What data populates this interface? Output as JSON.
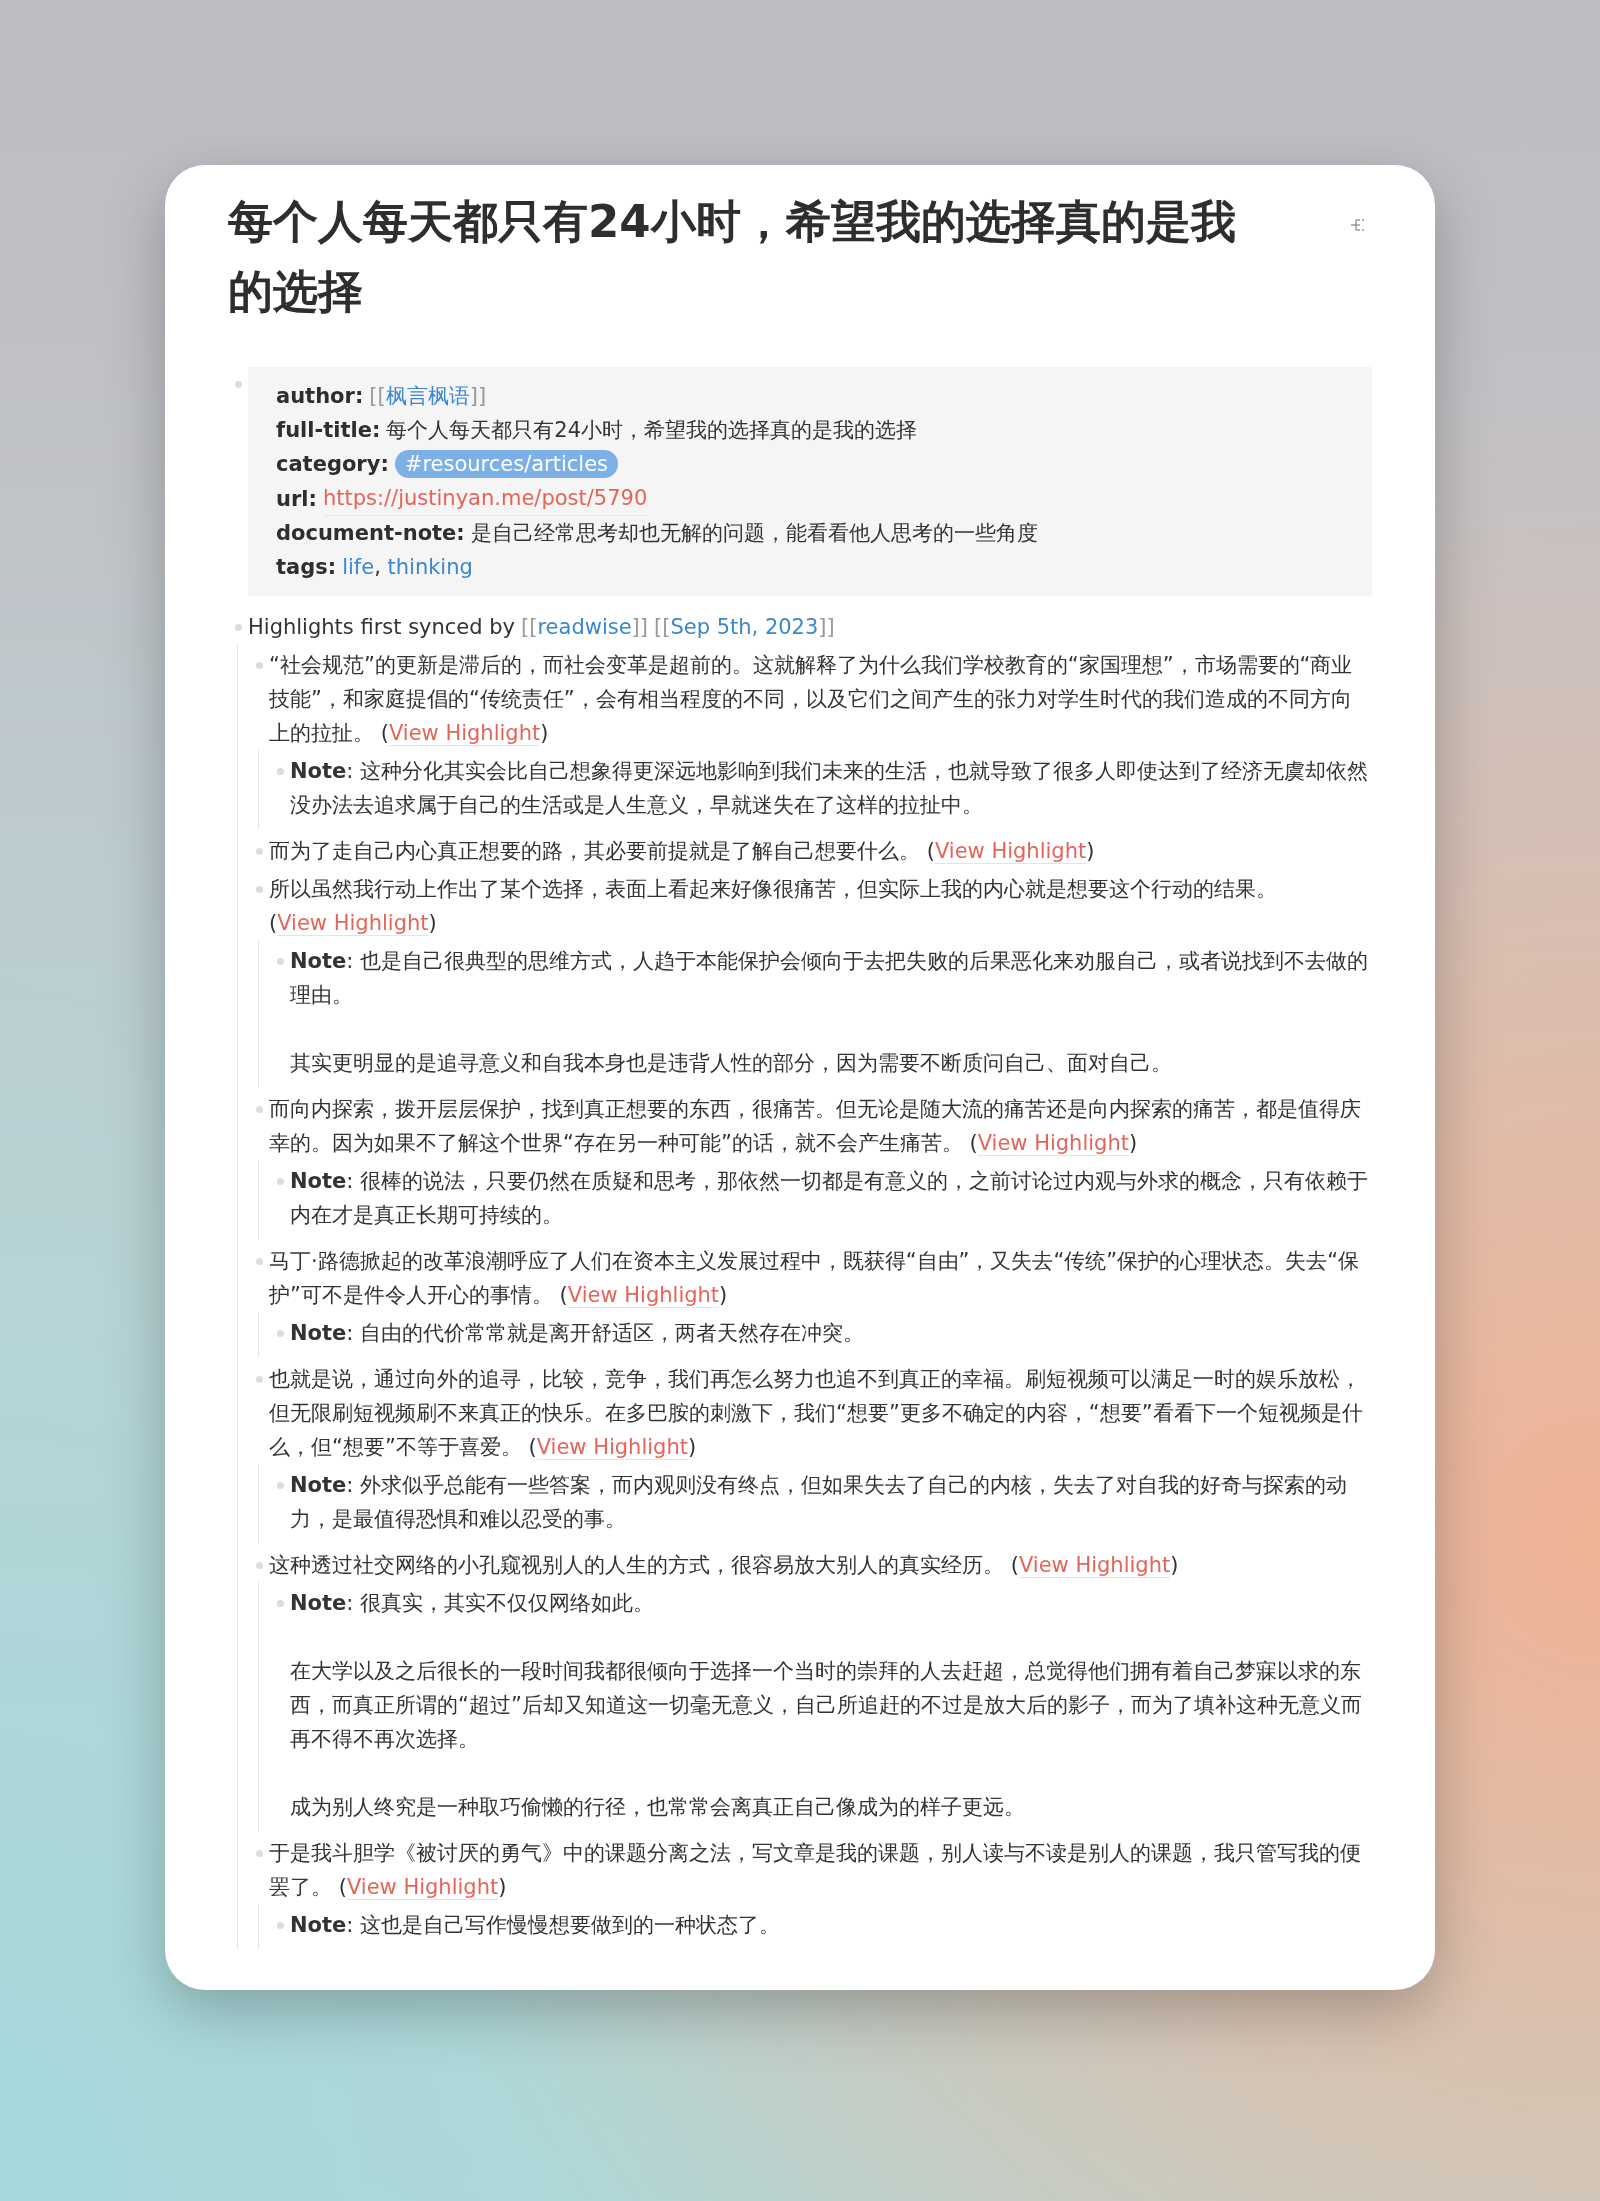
{
  "title": "每个人每天都只有24小时，希望我的选择真的是我的选择",
  "properties": [
    {
      "key": "author:",
      "kind": "page_ref",
      "ref": {
        "open": "[[",
        "text": "枫言枫语",
        "close": "]]"
      }
    },
    {
      "key": "full-title:",
      "kind": "text",
      "value": "每个人每天都只有24小时，希望我的选择真的是我的选择"
    },
    {
      "key": "category:",
      "kind": "tag",
      "value": "#resources/articles"
    },
    {
      "key": "url:",
      "kind": "url",
      "value": "https://justinyan.me/post/5790"
    },
    {
      "key": "document-note:",
      "kind": "text",
      "value": "是自己经常思考却也无解的问题，能看看他人思考的一些角度"
    },
    {
      "key": "tags:",
      "kind": "tags",
      "items": [
        {
          "text": "life",
          "suffix": ","
        },
        {
          "text": "thinking"
        }
      ]
    }
  ],
  "highlights_header": {
    "text": "Highlights first synced by",
    "refs": [
      {
        "open": "[[",
        "text": "readwise",
        "close": "]]"
      },
      {
        "open": "[[",
        "text": "Sep 5th, 2023",
        "close": "]]"
      }
    ]
  },
  "highlights": [
    {
      "text": "“社会规范”的更新是滞后的，而社会变革是超前的。这就解释了为什么我们学校教育的“家国理想”，市场需要的“商业技能”，和家庭提倡的“传统责任”，会有相当程度的不同，以及它们之间产生的张力对学生时代的我们造成的不同方向上的拉扯。",
      "link": {
        "open": "(",
        "text": "View Highlight",
        "close": ")"
      },
      "notes": [
        {
          "paragraphs": [
            "**Note**: 这种分化其实会比自己想象得更深远地影响到我们未来的生活，也就导致了很多人即使达到了经济无虞却依然没办法去追求属于自己的生活或是人生意义，早就迷失在了这样的拉扯中。"
          ]
        }
      ]
    },
    {
      "text": "而为了走自己内心真正想要的路，其必要前提就是了解自己想要什么。",
      "link": {
        "open": "(",
        "text": "View Highlight",
        "close": ")"
      }
    },
    {
      "text": "所以虽然我行动上作出了某个选择，表面上看起来好像很痛苦，但实际上我的内心就是想要这个行动的结果。",
      "link": {
        "open": "(",
        "text": "View Highlight",
        "close": ")"
      },
      "notes": [
        {
          "paragraphs": [
            "**Note**: 也是自己很典型的思维方式，人趋于本能保护会倾向于去把失败的后果恶化来劝服自己，或者说找到不去做的理由。",
            "其实更明显的是追寻意义和自我本身也是违背人性的部分，因为需要不断质问自己、面对自己。"
          ]
        }
      ]
    },
    {
      "text": "而向内探索，拨开层层保护，找到真正想要的东西，很痛苦。但无论是随大流的痛苦还是向内探索的痛苦，都是值得庆幸的。因为如果不了解这个世界“存在另一种可能”的话，就不会产生痛苦。",
      "link": {
        "open": "(",
        "text": "View Highlight",
        "close": ")"
      },
      "notes": [
        {
          "paragraphs": [
            "**Note**: 很棒的说法，只要仍然在质疑和思考，那依然一切都是有意义的，之前讨论过内观与外求的概念，只有依赖于内在才是真正长期可持续的。"
          ]
        }
      ]
    },
    {
      "text": "马丁·路德掀起的改革浪潮呼应了人们在资本主义发展过程中，既获得“自由”，又失去“传统”保护的心理状态。失去“保护”可不是件令人开心的事情。",
      "link": {
        "open": "(",
        "text": "View Highlight",
        "close": ")"
      },
      "notes": [
        {
          "paragraphs": [
            "**Note**: 自由的代价常常就是离开舒适区，两者天然存在冲突。"
          ]
        }
      ]
    },
    {
      "text": "也就是说，通过向外的追寻，比较，竞争，我们再怎么努力也追不到真正的幸福。刷短视频可以满足一时的娱乐放松，但无限刷短视频刷不来真正的快乐。在多巴胺的刺激下，我们“想要”更多不确定的内容，“想要”看看下一个短视频是什么，但“想要”不等于喜爱。",
      "link": {
        "open": "(",
        "text": "View Highlight",
        "close": ")"
      },
      "notes": [
        {
          "paragraphs": [
            "**Note**: 外求似乎总能有一些答案，而内观则没有终点，但如果失去了自己的内核，失去了对自我的好奇与探索的动力，是最值得恐惧和难以忍受的事。"
          ]
        }
      ]
    },
    {
      "text": "这种透过社交网络的小孔窥视别人的人生的方式，很容易放大别人的真实经历。",
      "link": {
        "open": "(",
        "text": "View Highlight",
        "close": ")"
      },
      "notes": [
        {
          "paragraphs": [
            "**Note**: 很真实，其实不仅仅网络如此。",
            "在大学以及之后很长的一段时间我都很倾向于选择一个当时的崇拜的人去赶超，总觉得他们拥有着自己梦寐以求的东西，而真正所谓的“超过”后却又知道这一切毫无意义，自己所追赶的不过是放大后的影子，而为了填补这种无意义而再不得不再次选择。",
            "成为别人终究是一种取巧偷懒的行径，也常常会离真正自己像成为的样子更远。"
          ]
        }
      ]
    },
    {
      "text": "于是我斗胆学《被讨厌的勇气》中的课题分离之法，写文章是我的课题，别人读与不读是别人的课题，我只管写我的便罢了。",
      "link": {
        "open": "(",
        "text": "View Highlight",
        "close": ")"
      },
      "notes": [
        {
          "paragraphs": [
            "**Note**: 这也是自己写作慢慢想要做到的一种状态了。"
          ]
        }
      ]
    }
  ]
}
